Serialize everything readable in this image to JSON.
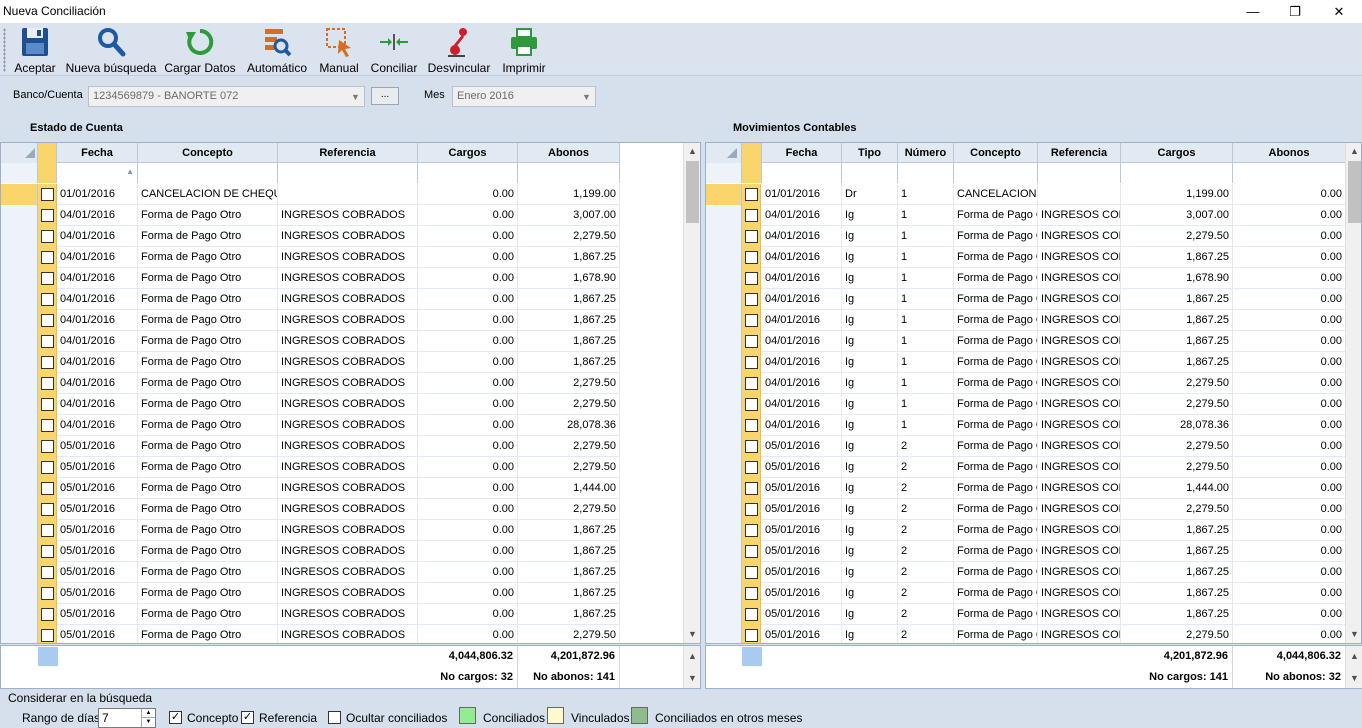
{
  "window": {
    "title": "Nueva Conciliación"
  },
  "toolbar": {
    "aceptar": "Aceptar",
    "nueva_busqueda": "Nueva búsqueda",
    "cargar_datos": "Cargar Datos",
    "automatico": "Automático",
    "manual": "Manual",
    "conciliar": "Conciliar",
    "desvincular": "Desvincular",
    "imprimir": "Imprimir"
  },
  "filters": {
    "banco_label": "Banco/Cuenta",
    "banco_value": "1234569879 - BANORTE  072",
    "browse_label": "...",
    "mes_label": "Mes",
    "mes_value": "Enero 2016"
  },
  "estado": {
    "title": "Estado de Cuenta",
    "headers": {
      "fecha": "Fecha",
      "concepto": "Concepto",
      "referencia": "Referencia",
      "cargos": "Cargos",
      "abonos": "Abonos"
    },
    "rows": [
      [
        "01/01/2016",
        "CANCELACION DE CHEQUE",
        "",
        "0.00",
        "1,199.00"
      ],
      [
        "04/01/2016",
        "Forma de Pago Otro",
        "INGRESOS COBRADOS",
        "0.00",
        "3,007.00"
      ],
      [
        "04/01/2016",
        "Forma de Pago Otro",
        "INGRESOS COBRADOS",
        "0.00",
        "2,279.50"
      ],
      [
        "04/01/2016",
        "Forma de Pago Otro",
        "INGRESOS COBRADOS",
        "0.00",
        "1,867.25"
      ],
      [
        "04/01/2016",
        "Forma de Pago Otro",
        "INGRESOS COBRADOS",
        "0.00",
        "1,678.90"
      ],
      [
        "04/01/2016",
        "Forma de Pago Otro",
        "INGRESOS COBRADOS",
        "0.00",
        "1,867.25"
      ],
      [
        "04/01/2016",
        "Forma de Pago Otro",
        "INGRESOS COBRADOS",
        "0.00",
        "1,867.25"
      ],
      [
        "04/01/2016",
        "Forma de Pago Otro",
        "INGRESOS COBRADOS",
        "0.00",
        "1,867.25"
      ],
      [
        "04/01/2016",
        "Forma de Pago Otro",
        "INGRESOS COBRADOS",
        "0.00",
        "1,867.25"
      ],
      [
        "04/01/2016",
        "Forma de Pago Otro",
        "INGRESOS COBRADOS",
        "0.00",
        "2,279.50"
      ],
      [
        "04/01/2016",
        "Forma de Pago Otro",
        "INGRESOS COBRADOS",
        "0.00",
        "2,279.50"
      ],
      [
        "04/01/2016",
        "Forma de Pago Otro",
        "INGRESOS COBRADOS",
        "0.00",
        "28,078.36"
      ],
      [
        "05/01/2016",
        "Forma de Pago Otro",
        "INGRESOS COBRADOS",
        "0.00",
        "2,279.50"
      ],
      [
        "05/01/2016",
        "Forma de Pago Otro",
        "INGRESOS COBRADOS",
        "0.00",
        "2,279.50"
      ],
      [
        "05/01/2016",
        "Forma de Pago Otro",
        "INGRESOS COBRADOS",
        "0.00",
        "1,444.00"
      ],
      [
        "05/01/2016",
        "Forma de Pago Otro",
        "INGRESOS COBRADOS",
        "0.00",
        "2,279.50"
      ],
      [
        "05/01/2016",
        "Forma de Pago Otro",
        "INGRESOS COBRADOS",
        "0.00",
        "1,867.25"
      ],
      [
        "05/01/2016",
        "Forma de Pago Otro",
        "INGRESOS COBRADOS",
        "0.00",
        "1,867.25"
      ],
      [
        "05/01/2016",
        "Forma de Pago Otro",
        "INGRESOS COBRADOS",
        "0.00",
        "1,867.25"
      ],
      [
        "05/01/2016",
        "Forma de Pago Otro",
        "INGRESOS COBRADOS",
        "0.00",
        "1,867.25"
      ],
      [
        "05/01/2016",
        "Forma de Pago Otro",
        "INGRESOS COBRADOS",
        "0.00",
        "1,867.25"
      ],
      [
        "05/01/2016",
        "Forma de Pago Otro",
        "INGRESOS COBRADOS",
        "0.00",
        "2,279.50"
      ]
    ],
    "totals": {
      "cargos": "4,044,806.32",
      "abonos": "4,201,872.96",
      "no_cargos": "No cargos: 32",
      "no_abonos": "No abonos: 141"
    }
  },
  "movimientos": {
    "title": "Movimientos Contables",
    "headers": {
      "fecha": "Fecha",
      "tipo": "Tipo",
      "numero": "Número",
      "concepto": "Concepto",
      "referencia": "Referencia",
      "cargos": "Cargos",
      "abonos": "Abonos"
    },
    "rows": [
      [
        "01/01/2016",
        "Dr",
        "1",
        "CANCELACION DE",
        "",
        "1,199.00",
        "0.00"
      ],
      [
        "04/01/2016",
        "Ig",
        "1",
        "Forma de Pago Otro",
        "INGRESOS COBRADOS",
        "3,007.00",
        "0.00"
      ],
      [
        "04/01/2016",
        "Ig",
        "1",
        "Forma de Pago Otro",
        "INGRESOS COBRADOS",
        "2,279.50",
        "0.00"
      ],
      [
        "04/01/2016",
        "Ig",
        "1",
        "Forma de Pago Otro",
        "INGRESOS COBRADOS",
        "1,867.25",
        "0.00"
      ],
      [
        "04/01/2016",
        "Ig",
        "1",
        "Forma de Pago Otro",
        "INGRESOS COBRADOS",
        "1,678.90",
        "0.00"
      ],
      [
        "04/01/2016",
        "Ig",
        "1",
        "Forma de Pago Otro",
        "INGRESOS COBRADOS",
        "1,867.25",
        "0.00"
      ],
      [
        "04/01/2016",
        "Ig",
        "1",
        "Forma de Pago Otro",
        "INGRESOS COBRADOS",
        "1,867.25",
        "0.00"
      ],
      [
        "04/01/2016",
        "Ig",
        "1",
        "Forma de Pago Otro",
        "INGRESOS COBRADOS",
        "1,867.25",
        "0.00"
      ],
      [
        "04/01/2016",
        "Ig",
        "1",
        "Forma de Pago Otro",
        "INGRESOS COBRADOS",
        "1,867.25",
        "0.00"
      ],
      [
        "04/01/2016",
        "Ig",
        "1",
        "Forma de Pago Otro",
        "INGRESOS COBRADOS",
        "2,279.50",
        "0.00"
      ],
      [
        "04/01/2016",
        "Ig",
        "1",
        "Forma de Pago Otro",
        "INGRESOS COBRADOS",
        "2,279.50",
        "0.00"
      ],
      [
        "04/01/2016",
        "Ig",
        "1",
        "Forma de Pago Otro",
        "INGRESOS COBRADOS",
        "28,078.36",
        "0.00"
      ],
      [
        "05/01/2016",
        "Ig",
        "2",
        "Forma de Pago Otro",
        "INGRESOS COBRADOS",
        "2,279.50",
        "0.00"
      ],
      [
        "05/01/2016",
        "Ig",
        "2",
        "Forma de Pago Otro",
        "INGRESOS COBRADOS",
        "2,279.50",
        "0.00"
      ],
      [
        "05/01/2016",
        "Ig",
        "2",
        "Forma de Pago Otro",
        "INGRESOS COBRADOS",
        "1,444.00",
        "0.00"
      ],
      [
        "05/01/2016",
        "Ig",
        "2",
        "Forma de Pago Otro",
        "INGRESOS COBRADOS",
        "2,279.50",
        "0.00"
      ],
      [
        "05/01/2016",
        "Ig",
        "2",
        "Forma de Pago Otro",
        "INGRESOS COBRADOS",
        "1,867.25",
        "0.00"
      ],
      [
        "05/01/2016",
        "Ig",
        "2",
        "Forma de Pago Otro",
        "INGRESOS COBRADOS",
        "1,867.25",
        "0.00"
      ],
      [
        "05/01/2016",
        "Ig",
        "2",
        "Forma de Pago Otro",
        "INGRESOS COBRADOS",
        "1,867.25",
        "0.00"
      ],
      [
        "05/01/2016",
        "Ig",
        "2",
        "Forma de Pago Otro",
        "INGRESOS COBRADOS",
        "1,867.25",
        "0.00"
      ],
      [
        "05/01/2016",
        "Ig",
        "2",
        "Forma de Pago Otro",
        "INGRESOS COBRADOS",
        "1,867.25",
        "0.00"
      ],
      [
        "05/01/2016",
        "Ig",
        "2",
        "Forma de Pago Otro",
        "INGRESOS COBRADOS",
        "2,279.50",
        "0.00"
      ]
    ],
    "totals": {
      "cargos": "4,201,872.96",
      "abonos": "4,044,806.32",
      "no_cargos": "No cargos: 141",
      "no_abonos": "No abonos: 32"
    }
  },
  "options": {
    "group_label": "Considerar en la búsqueda",
    "rango_label": "Rango de días",
    "rango_value": "7",
    "concepto_label": "Concepto",
    "concepto_checked": true,
    "referencia_label": "Referencia",
    "referencia_checked": true,
    "ocultar_label": "Ocultar conciliados",
    "ocultar_checked": false
  },
  "legend": {
    "conciliados": "Conciliados",
    "vinculados": "Vinculados",
    "otros_meses": "Conciliados en otros meses",
    "colors": {
      "conciliados": "#90ee90",
      "vinculados": "#fffacd",
      "otros_meses": "#8fbc8f"
    }
  },
  "colors": {
    "accent_yellow": "#f9d56b",
    "header_bg": "#e1e9f3",
    "panel_bg": "#d6e0ec"
  }
}
